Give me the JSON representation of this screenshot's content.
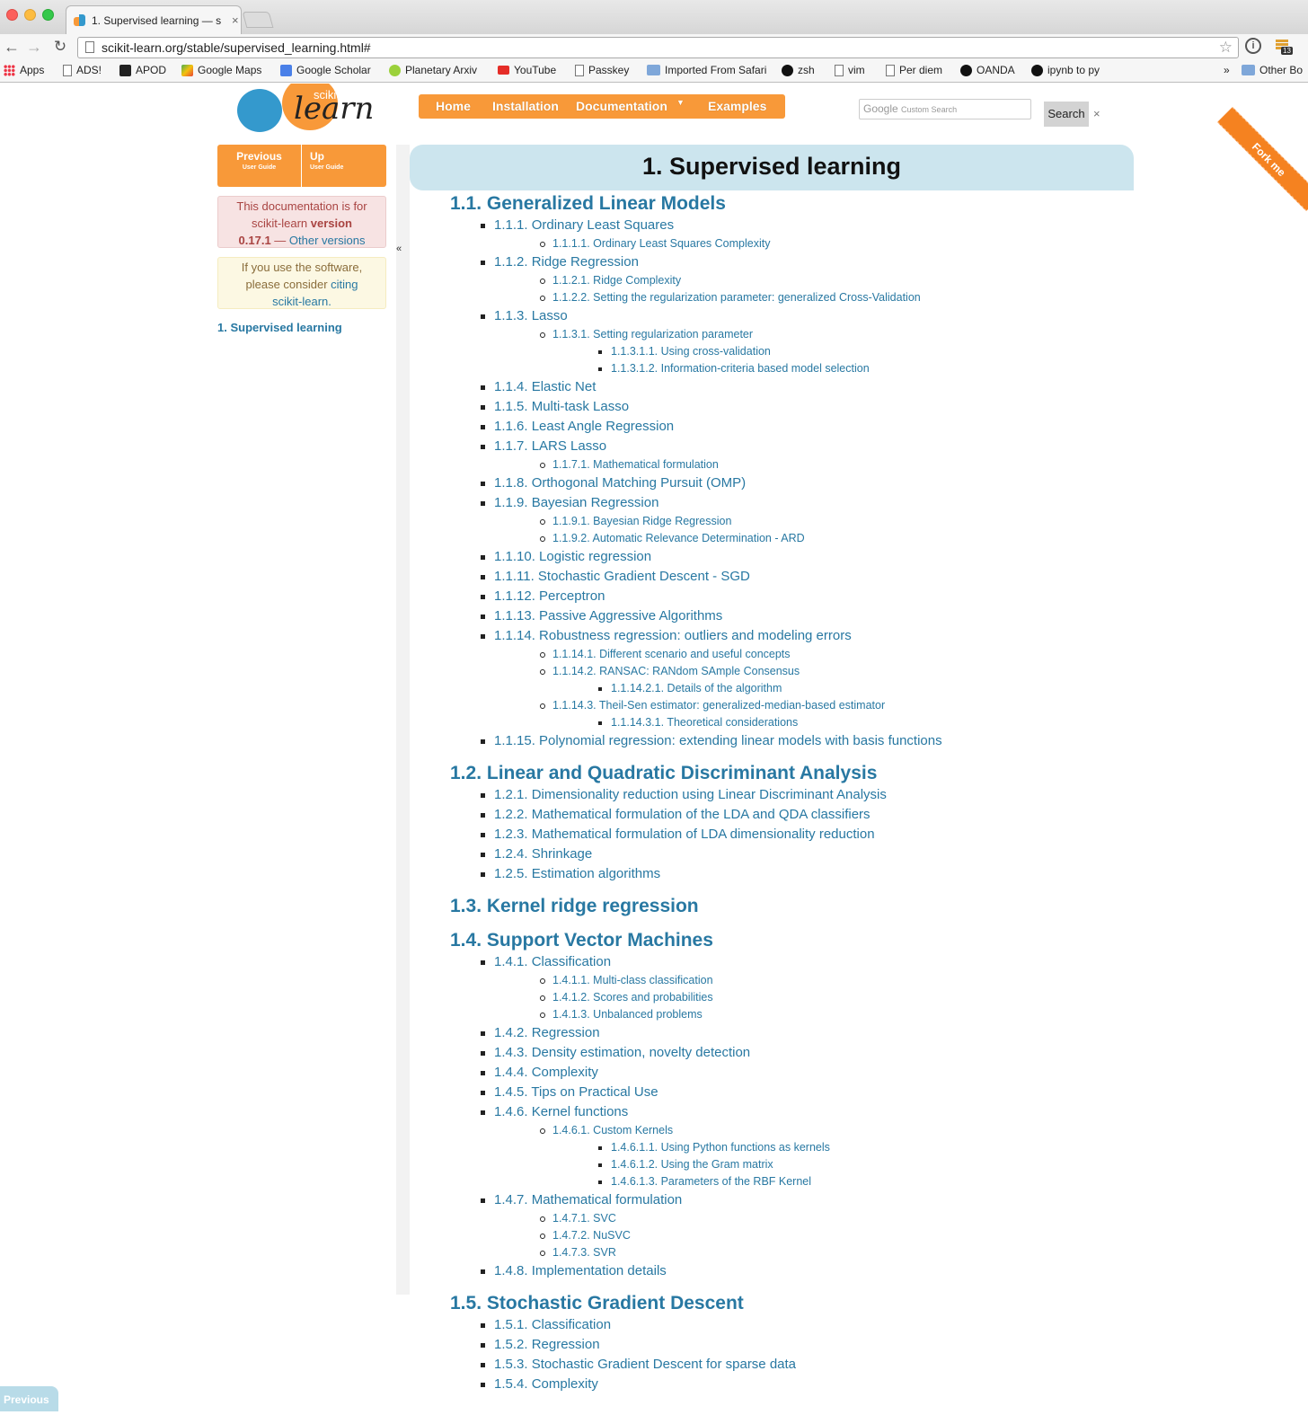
{
  "browser": {
    "tab_title": "1. Supervised learning — s",
    "tab_close": "×",
    "url": "scikit-learn.org/stable/supervised_learning.html#",
    "ext_badge": "13",
    "bookmarks": [
      {
        "label": "Apps",
        "icon": "apps-grid-icon"
      },
      {
        "label": "ADS!",
        "icon": "document-icon"
      },
      {
        "label": "APOD",
        "icon": "apod-icon"
      },
      {
        "label": "Google Maps",
        "icon": "maps-icon"
      },
      {
        "label": "Google Scholar",
        "icon": "scholar-icon"
      },
      {
        "label": "Planetary Arxiv",
        "icon": "frog-icon"
      },
      {
        "label": "YouTube",
        "icon": "youtube-icon"
      },
      {
        "label": "Passkey",
        "icon": "document-icon"
      },
      {
        "label": "Imported From Safari",
        "icon": "folder-icon"
      },
      {
        "label": "zsh",
        "icon": "github-icon"
      },
      {
        "label": "vim",
        "icon": "document-icon"
      },
      {
        "label": "Per diem",
        "icon": "document-icon"
      },
      {
        "label": "OANDA",
        "icon": "oanda-icon"
      },
      {
        "label": "ipynb to py",
        "icon": "github-icon"
      }
    ],
    "bookmarks_overflow": "»",
    "other_bookmarks": "Other Bo"
  },
  "site": {
    "logo_small": "scikit",
    "logo_big": "learn",
    "nav": {
      "home": "Home",
      "installation": "Installation",
      "documentation": "Documentation",
      "documentation_caret": "▼",
      "examples": "Examples"
    },
    "search": {
      "google": "Google",
      "placeholder": "Custom Search",
      "button": "Search",
      "clear": "×"
    },
    "fork_ribbon": "Fork me"
  },
  "sidebar": {
    "prev_label": "Previous",
    "prev_sub": "User Guide",
    "up_label": "Up",
    "up_sub": "User Guide",
    "version_line1": "This documentation is for",
    "version_line2a": "scikit-learn ",
    "version_line2b": "version",
    "version_number": "0.17.1",
    "version_sep": " — ",
    "version_link": "Other versions",
    "cite_line1": "If you use the software,",
    "cite_line2a": "please consider ",
    "cite_line2b": "citing",
    "cite_line3": "scikit-learn.",
    "toc_current": "1. Supervised learning",
    "collapse": "«"
  },
  "page_title": "1. Supervised learning",
  "toc": [
    {
      "title": "1.1. Generalized Linear Models",
      "items": [
        {
          "label": "1.1.1. Ordinary Least Squares",
          "sub": [
            {
              "label": "1.1.1.1. Ordinary Least Squares Complexity"
            }
          ]
        },
        {
          "label": "1.1.2. Ridge Regression",
          "sub": [
            {
              "label": "1.1.2.1. Ridge Complexity"
            },
            {
              "label": "1.1.2.2. Setting the regularization parameter: generalized Cross-Validation"
            }
          ]
        },
        {
          "label": "1.1.3. Lasso",
          "sub": [
            {
              "label": "1.1.3.1. Setting regularization parameter",
              "sub": [
                "1.1.3.1.1. Using cross-validation",
                "1.1.3.1.2. Information-criteria based model selection"
              ]
            }
          ]
        },
        {
          "label": "1.1.4. Elastic Net"
        },
        {
          "label": "1.1.5. Multi-task Lasso"
        },
        {
          "label": "1.1.6. Least Angle Regression"
        },
        {
          "label": "1.1.7. LARS Lasso",
          "sub": [
            {
              "label": "1.1.7.1. Mathematical formulation"
            }
          ]
        },
        {
          "label": "1.1.8. Orthogonal Matching Pursuit (OMP)"
        },
        {
          "label": "1.1.9. Bayesian Regression",
          "sub": [
            {
              "label": "1.1.9.1. Bayesian Ridge Regression"
            },
            {
              "label": "1.1.9.2. Automatic Relevance Determination - ARD"
            }
          ]
        },
        {
          "label": "1.1.10. Logistic regression"
        },
        {
          "label": "1.1.11. Stochastic Gradient Descent - SGD"
        },
        {
          "label": "1.1.12. Perceptron"
        },
        {
          "label": "1.1.13. Passive Aggressive Algorithms"
        },
        {
          "label": "1.1.14. Robustness regression: outliers and modeling errors",
          "sub": [
            {
              "label": "1.1.14.1. Different scenario and useful concepts"
            },
            {
              "label": "1.1.14.2. RANSAC: RANdom SAmple Consensus",
              "sub": [
                "1.1.14.2.1. Details of the algorithm"
              ]
            },
            {
              "label": "1.1.14.3. Theil-Sen estimator: generalized-median-based estimator",
              "sub": [
                "1.1.14.3.1. Theoretical considerations"
              ]
            }
          ]
        },
        {
          "label": "1.1.15. Polynomial regression: extending linear models with basis functions"
        }
      ]
    },
    {
      "title": "1.2. Linear and Quadratic Discriminant Analysis",
      "items": [
        {
          "label": "1.2.1. Dimensionality reduction using Linear Discriminant Analysis"
        },
        {
          "label": "1.2.2. Mathematical formulation of the LDA and QDA classifiers"
        },
        {
          "label": "1.2.3. Mathematical formulation of LDA dimensionality reduction"
        },
        {
          "label": "1.2.4. Shrinkage"
        },
        {
          "label": "1.2.5. Estimation algorithms"
        }
      ]
    },
    {
      "title": "1.3. Kernel ridge regression",
      "items": []
    },
    {
      "title": "1.4. Support Vector Machines",
      "items": [
        {
          "label": "1.4.1. Classification",
          "sub": [
            {
              "label": "1.4.1.1. Multi-class classification"
            },
            {
              "label": "1.4.1.2. Scores and probabilities"
            },
            {
              "label": "1.4.1.3. Unbalanced problems"
            }
          ]
        },
        {
          "label": "1.4.2. Regression"
        },
        {
          "label": "1.4.3. Density estimation, novelty detection"
        },
        {
          "label": "1.4.4. Complexity"
        },
        {
          "label": "1.4.5. Tips on Practical Use"
        },
        {
          "label": "1.4.6. Kernel functions",
          "sub": [
            {
              "label": "1.4.6.1. Custom Kernels",
              "sub": [
                "1.4.6.1.1. Using Python functions as kernels",
                "1.4.6.1.2. Using the Gram matrix",
                "1.4.6.1.3. Parameters of the RBF Kernel"
              ]
            }
          ]
        },
        {
          "label": "1.4.7. Mathematical formulation",
          "sub": [
            {
              "label": "1.4.7.1. SVC"
            },
            {
              "label": "1.4.7.2. NuSVC"
            },
            {
              "label": "1.4.7.3. SVR"
            }
          ]
        },
        {
          "label": "1.4.8. Implementation details"
        }
      ]
    },
    {
      "title": "1.5. Stochastic Gradient Descent",
      "items": [
        {
          "label": "1.5.1. Classification"
        },
        {
          "label": "1.5.2. Regression"
        },
        {
          "label": "1.5.3. Stochastic Gradient Descent for sparse data"
        },
        {
          "label": "1.5.4. Complexity"
        }
      ]
    }
  ],
  "floating_prev": "Previous",
  "colors": {
    "brand_orange": "#f89939",
    "brand_blue": "#3499cd",
    "link": "#2878a2",
    "title_band": "#cce5ee"
  }
}
